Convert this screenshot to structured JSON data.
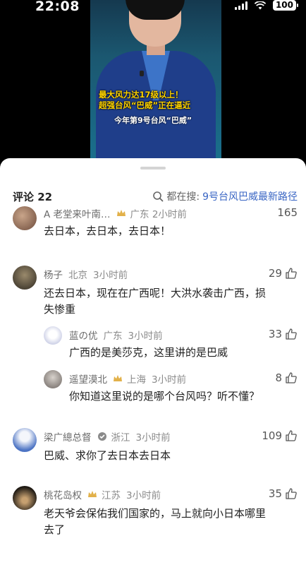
{
  "status": {
    "time": "22:08",
    "battery": "100"
  },
  "video": {
    "caption_line1": "最大风力达17级以上！",
    "caption_line2": "超强台风“巴威”正在逼近",
    "caption_line3": "今年第9号台风“巴威”"
  },
  "header": {
    "comment_count": "评论 22",
    "search_prefix": "都在搜:",
    "search_term": "9号台风巴威最新路径",
    "search_icon": "search-icon"
  },
  "comments": [
    {
      "name": "A 老堂来叶南…",
      "location": "广东 2小时前",
      "likes": "165",
      "text": "去日本，去日本，去日本！"
    },
    {
      "name": "杨子",
      "location": "北京",
      "time": "3小时前",
      "likes": "29",
      "text_line1": "还去日本，现在在广西呢！大洪水袭击广西，损",
      "text_line2": "失惨重"
    },
    {
      "name": "蓝の优",
      "location": "广东",
      "time": "3小时前",
      "likes": "33",
      "text": "广西的是美莎克，这里讲的是巴威"
    },
    {
      "name": "遥望漠北",
      "location": "上海",
      "time": "3小时前",
      "likes": "8",
      "text": "你知道这里说的是哪个台风吗？听不懂？"
    },
    {
      "name": "梁广總总督",
      "location": "浙江",
      "time": "3小时前",
      "likes": "109",
      "text": "巴威、求你了去日本去日本"
    },
    {
      "name": "桃花岛权",
      "location": "江苏",
      "time": "3小时前",
      "likes": "35",
      "text_line1": "老天爷会保佑我们国家的，马上就向小日本哪里",
      "text_line2": "去了"
    }
  ],
  "colors": {
    "accent": "#3a66c4",
    "gold_badge": "#e2b14a"
  }
}
